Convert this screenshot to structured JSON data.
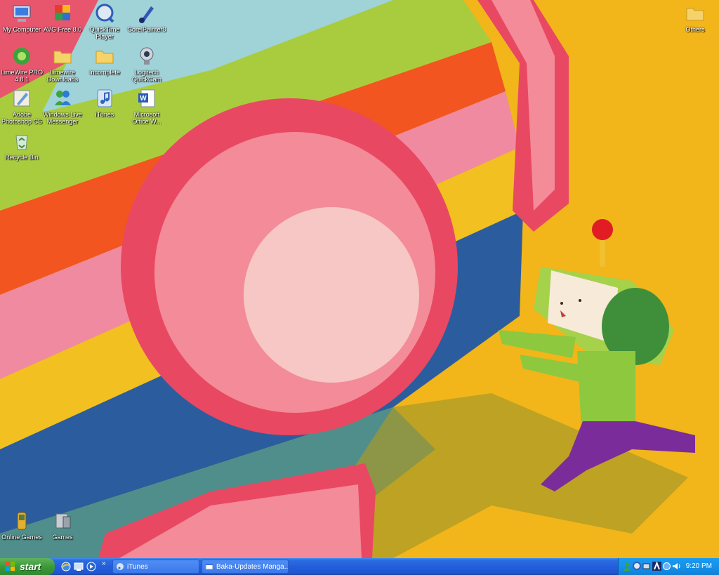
{
  "desktop": {
    "icons": [
      {
        "name": "my-computer-icon",
        "label": "My Computer"
      },
      {
        "name": "avg-icon",
        "label": "AVG Free 8.0"
      },
      {
        "name": "quicktime-icon",
        "label": "QuickTime Player"
      },
      {
        "name": "corel-painter-icon",
        "label": "CorelPainter8"
      },
      {
        "name": "limewire-icon",
        "label": "LimeWire PRO 4.8.1"
      },
      {
        "name": "folder-icon",
        "label": "Limewire Downloads"
      },
      {
        "name": "folder-icon",
        "label": "Incomplete"
      },
      {
        "name": "webcam-icon",
        "label": "Logitech QuickCam"
      },
      {
        "name": "photoshop-icon",
        "label": "Adobe Photoshop CS"
      },
      {
        "name": "messenger-icon",
        "label": "Windows Live Messenger"
      },
      {
        "name": "itunes-icon",
        "label": "iTunes"
      },
      {
        "name": "word-icon",
        "label": "Microsoft Office W..."
      },
      {
        "name": "recycle-bin-icon",
        "label": "Recycle Bin"
      },
      {
        "name": "folder-icon",
        "label": "Others"
      },
      {
        "name": "online-games-icon",
        "label": "Online Games"
      },
      {
        "name": "games-icon",
        "label": "Games"
      }
    ]
  },
  "taskbar": {
    "start_label": "start",
    "quick_launch": [
      "internet-explorer-icon",
      "desktop-icon",
      "media-player-icon"
    ],
    "tasks": [
      {
        "label": "iTunes",
        "icon": "itunes-icon"
      },
      {
        "label": "Baka-Updates Manga...",
        "icon": "window-icon"
      }
    ],
    "tray_icons": [
      "messenger-tray-icon",
      "quicktime-tray-icon",
      "network-tray-icon",
      "avg-tray-icon",
      "sync-tray-icon",
      "volume-tray-icon"
    ],
    "clock": "9:20 PM"
  },
  "colors": {
    "taskbar": "#245edb",
    "start": "#3c9a3a",
    "tray": "#1491e8",
    "wallpaper_yellow": "#f2b51a",
    "ball_pink": "#e8566e"
  }
}
